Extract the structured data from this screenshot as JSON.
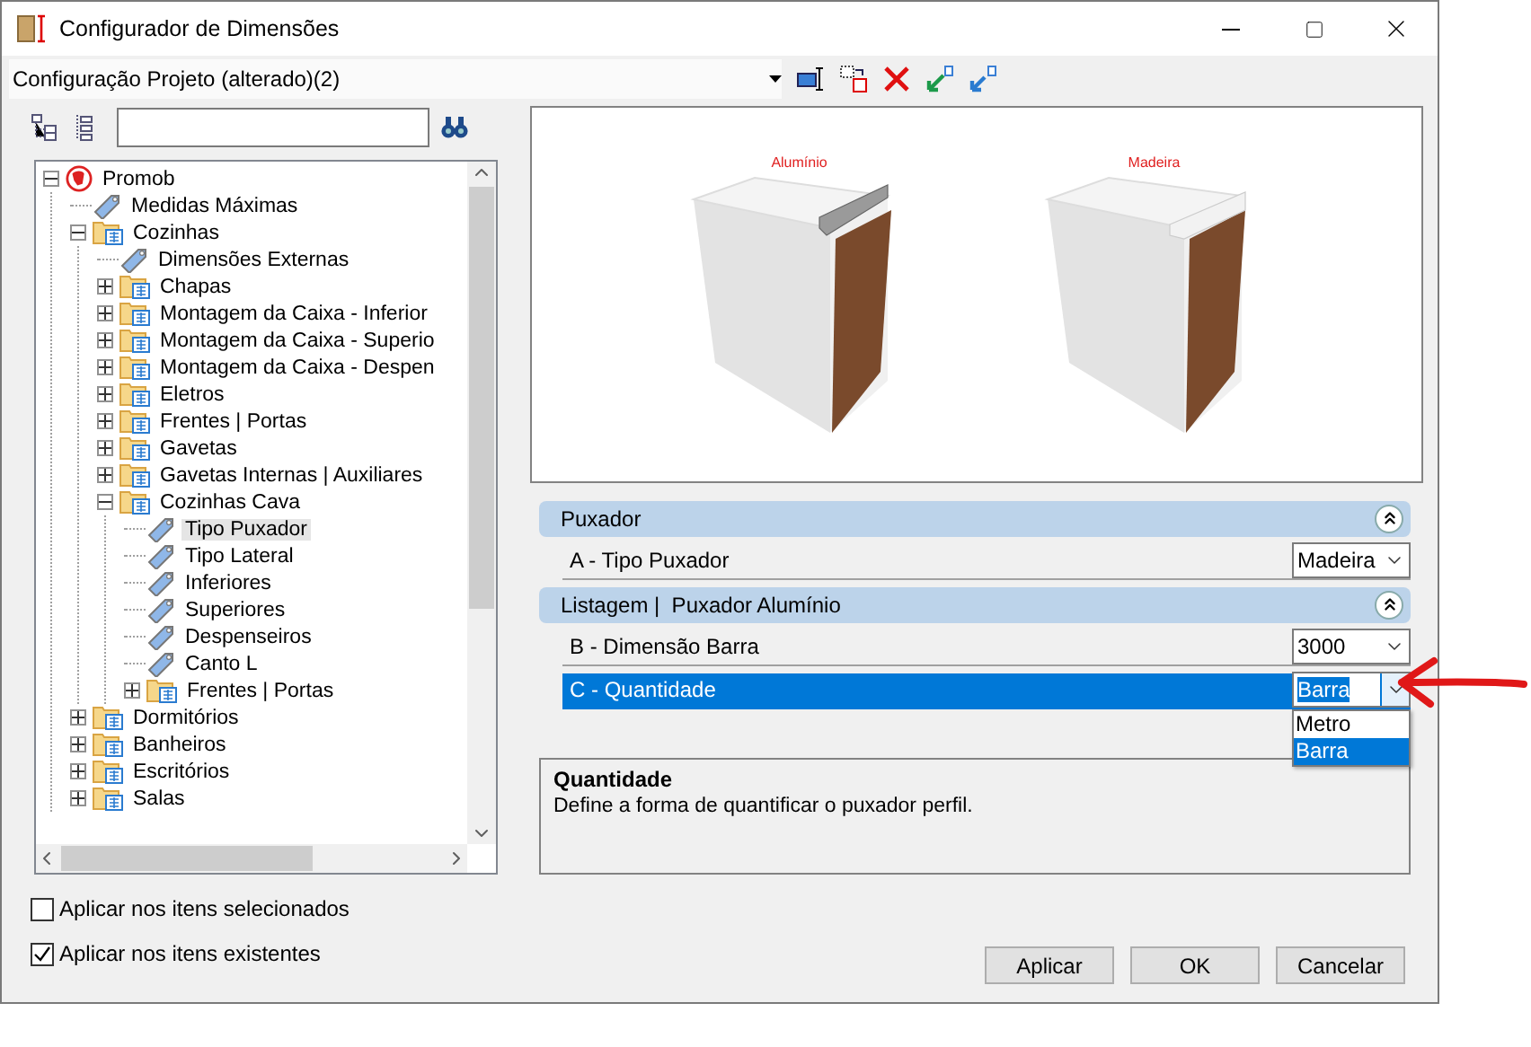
{
  "window": {
    "title": "Configurador de Dimensões"
  },
  "configuration": {
    "value": "Configuração Projeto (alterado)(2)"
  },
  "tree": [
    {
      "label": "Promob",
      "kind": "root",
      "expanded": true,
      "selected": false,
      "children": [
        {
          "label": "Medidas Máximas",
          "kind": "tag",
          "selected": false
        },
        {
          "label": "Cozinhas",
          "kind": "folder",
          "expanded": true,
          "selected": false,
          "children": [
            {
              "label": "Dimensões Externas",
              "kind": "tag",
              "selected": false
            },
            {
              "label": "Chapas",
              "kind": "folder",
              "expanded": false,
              "selected": false
            },
            {
              "label": "Montagem da Caixa - Inferior",
              "kind": "folder",
              "expanded": false,
              "selected": false
            },
            {
              "label": "Montagem da Caixa - Superio",
              "kind": "folder",
              "expanded": false,
              "selected": false
            },
            {
              "label": "Montagem da Caixa - Despen",
              "kind": "folder",
              "expanded": false,
              "selected": false
            },
            {
              "label": "Eletros",
              "kind": "folder",
              "expanded": false,
              "selected": false
            },
            {
              "label": "Frentes | Portas",
              "kind": "folder",
              "expanded": false,
              "selected": false
            },
            {
              "label": "Gavetas",
              "kind": "folder",
              "expanded": false,
              "selected": false
            },
            {
              "label": "Gavetas Internas | Auxiliares",
              "kind": "folder",
              "expanded": false,
              "selected": false
            },
            {
              "label": "Cozinhas Cava",
              "kind": "folder",
              "expanded": true,
              "selected": false,
              "children": [
                {
                  "label": "Tipo Puxador",
                  "kind": "tag",
                  "selected": true
                },
                {
                  "label": "Tipo Lateral",
                  "kind": "tag",
                  "selected": false
                },
                {
                  "label": "Inferiores",
                  "kind": "tag",
                  "selected": false
                },
                {
                  "label": "Superiores",
                  "kind": "tag",
                  "selected": false
                },
                {
                  "label": "Despenseiros",
                  "kind": "tag",
                  "selected": false
                },
                {
                  "label": "Canto L",
                  "kind": "tag",
                  "selected": false
                },
                {
                  "label": "Frentes | Portas",
                  "kind": "folder",
                  "expanded": false,
                  "selected": false
                }
              ]
            }
          ]
        },
        {
          "label": "Dormitórios",
          "kind": "folder",
          "expanded": false,
          "selected": false
        },
        {
          "label": "Banheiros",
          "kind": "folder",
          "expanded": false,
          "selected": false
        },
        {
          "label": "Escritórios",
          "kind": "folder",
          "expanded": false,
          "selected": false
        },
        {
          "label": "Salas",
          "kind": "folder",
          "expanded": false,
          "selected": false
        }
      ]
    }
  ],
  "preview": {
    "items": [
      {
        "label": "Alumínio",
        "kind": "aluminum"
      },
      {
        "label": "Madeira",
        "kind": "wood"
      }
    ]
  },
  "property_groups": [
    {
      "title": "Puxador",
      "expanded": true,
      "rows": [
        {
          "label": "A - Tipo Puxador",
          "value": "Madeira",
          "selected": false
        }
      ]
    },
    {
      "title": "Listagem |  Puxador Alumínio",
      "expanded": true,
      "rows": [
        {
          "label": "B - Dimensão Barra",
          "value": "3000",
          "selected": false
        },
        {
          "label": "C - Quantidade",
          "value": "Barra",
          "selected": true,
          "options": [
            {
              "label": "Metro",
              "selected": false
            },
            {
              "label": "Barra",
              "selected": true
            }
          ]
        }
      ]
    }
  ],
  "description": {
    "title": "Quantidade",
    "text": "Define a forma de quantificar o puxador perfil."
  },
  "checkboxes": [
    {
      "label": "Aplicar nos itens selecionados",
      "checked": false
    },
    {
      "label": "Aplicar nos itens existentes",
      "checked": true
    }
  ],
  "buttons": [
    "Aplicar",
    "OK",
    "Cancelar"
  ]
}
